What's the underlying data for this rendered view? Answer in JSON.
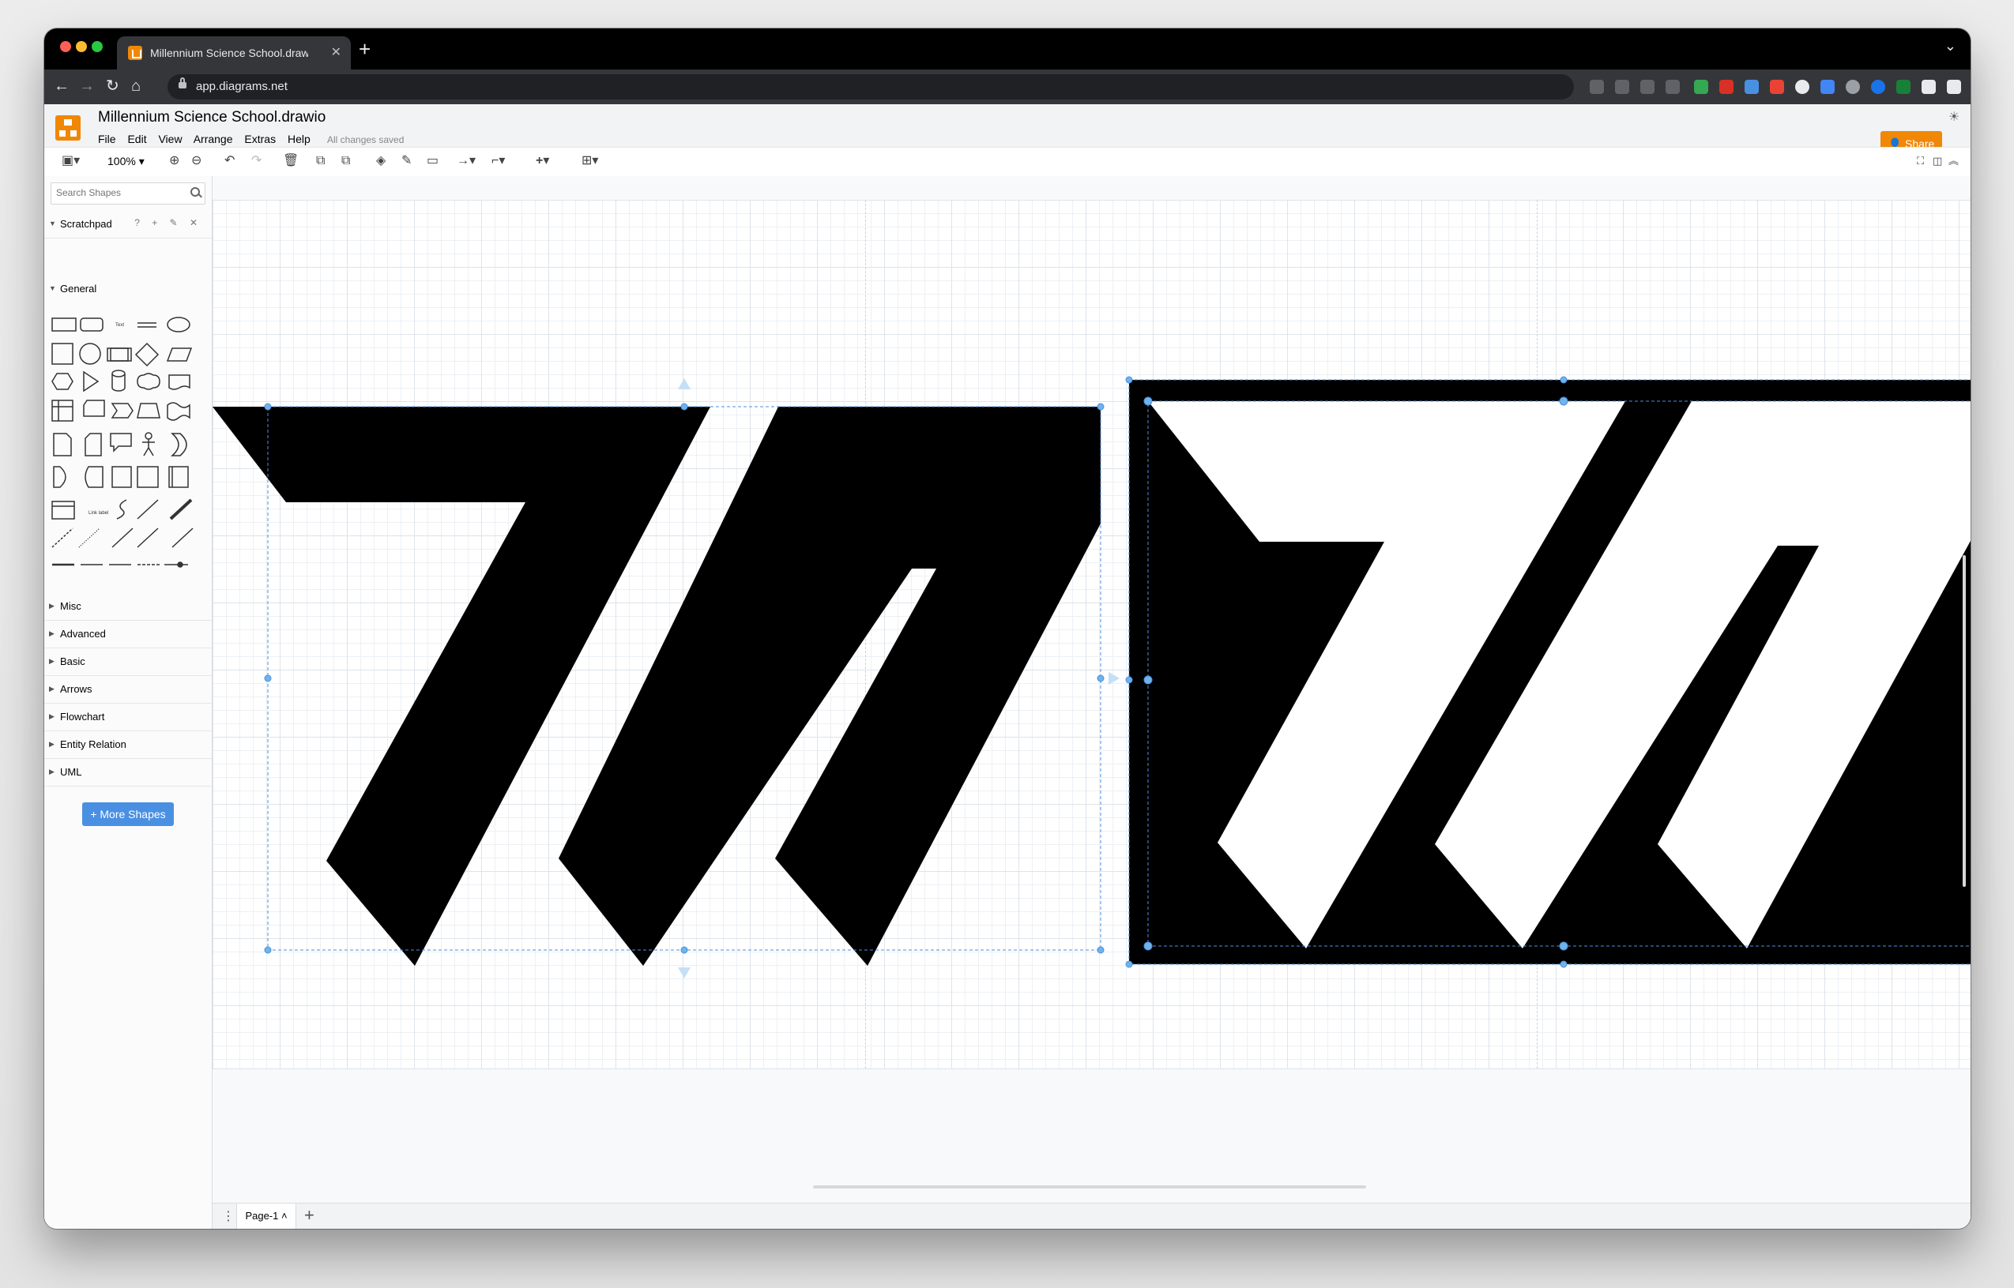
{
  "browser": {
    "tab_title": "Millennium Science School.drawio",
    "tab_close": "✕",
    "new_tab": "+",
    "tab_menu": "⌄",
    "back": "←",
    "forward": "→",
    "reload": "↻",
    "home": "⌂",
    "url": "app.diagrams.net"
  },
  "app": {
    "doc_title": "Millennium Science School.drawio",
    "menu": [
      "File",
      "Edit",
      "View",
      "Arrange",
      "Extras",
      "Help"
    ],
    "save_status": "All changes saved",
    "share_label": "Share",
    "accent_color": "#f08705"
  },
  "toolbar": {
    "zoom": "100%",
    "zoom_in": "⊕",
    "zoom_out": "⊖",
    "undo": "↶",
    "redo": "↷",
    "delete": "🗑",
    "insert": "+",
    "format": "⊞",
    "fullscreen": "⛶"
  },
  "sidebar": {
    "search_placeholder": "Search Shapes",
    "scratchpad": "Scratchpad",
    "scratchpad_tools": "? + ✎ ✕",
    "general": "General",
    "sections": [
      "Misc",
      "Advanced",
      "Basic",
      "Arrows",
      "Flowchart",
      "Entity Relation",
      "UML"
    ],
    "more_shapes": "+ More Shapes"
  },
  "footer": {
    "page_name": "Page-1 ˄",
    "add_page": "+"
  },
  "canvas": {
    "fill_colors": {
      "ink": "#000000",
      "paper": "#ffffff",
      "selection": "#4a90e2"
    }
  }
}
